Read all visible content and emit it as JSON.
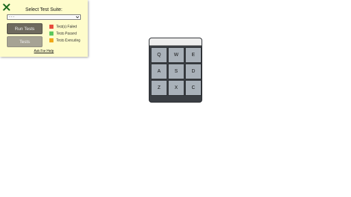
{
  "panel": {
    "title": "Select Test Suite:",
    "suite_select_value": "- - -",
    "run_button_label": "Run Tests",
    "tests_button_label": "Tests",
    "help_link_label": "Ask For Help",
    "legend": [
      {
        "label": "Test(s) Failed",
        "color": "#e74c3c"
      },
      {
        "label": "Tests Passed",
        "color": "#5cc85c"
      },
      {
        "label": "Tests Executing",
        "color": "#f0a818"
      }
    ],
    "close_icon": "close-x-icon",
    "close_color": "#1e6b1e"
  },
  "keypad": {
    "keys": [
      "Q",
      "W",
      "E",
      "A",
      "S",
      "D",
      "Z",
      "X",
      "C"
    ]
  }
}
